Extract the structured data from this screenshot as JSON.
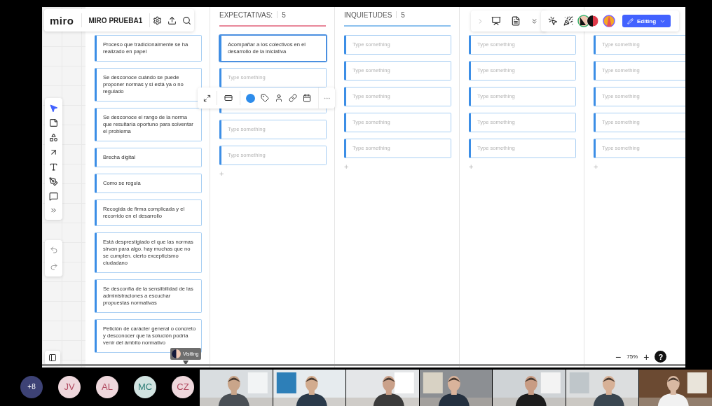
{
  "top_bar": {
    "logo": "miro",
    "board_name": "MIRO PRUEBA1"
  },
  "editing_button": {
    "label": "Editing"
  },
  "columns": [
    {
      "cards": [
        {
          "text": "Proceso que tradicionalmente se ha realizado en papel",
          "selected": false
        },
        {
          "text": "Se desconoce cuándo se puede proponer normas y si está ya o no regulado",
          "selected": false
        },
        {
          "text": "Se desconoce el rango de la norma que resultaría oportuno para solventar el problema",
          "selected": false
        },
        {
          "text": "Brecha digital",
          "selected": false
        },
        {
          "text": "Como se  regula",
          "selected": false
        },
        {
          "text": "Recogida de firma complicada y el recorrido en el desarrollo",
          "selected": false
        },
        {
          "text": "Está desprestigiado el que las normas sirvan para algo. hay muchas que no se cumplen. cierto excepticismo ciudadano",
          "selected": false
        },
        {
          "text": "Se desconfía de la sensiibilidad de las administraciones a escuchar propuestas normativas",
          "selected": false
        },
        {
          "text": "Petición de carácter general o concreto y desconocer que la solución podría venir del ámbito normativo",
          "selected": false
        }
      ]
    },
    {
      "title": "EXPECTATIVAS:",
      "count": "5",
      "color": "#e8879a",
      "add": "+",
      "cards": [
        {
          "text": "Acompañar a los colectivos en el desarrollo de la iniciativa",
          "selected": true
        },
        {
          "placeholder": "Type something",
          "selected": false
        },
        {
          "selected": false
        },
        {
          "placeholder": "Type something",
          "selected": false
        },
        {
          "placeholder": "Type something",
          "selected": false
        }
      ]
    },
    {
      "title": "INQUIETUDES",
      "count": "5",
      "color": "#8cc0ee",
      "add": "+",
      "cards": [
        {
          "placeholder": "Type something",
          "selected": false
        },
        {
          "placeholder": "Type something",
          "selected": false
        },
        {
          "placeholder": "Type something",
          "selected": false
        },
        {
          "placeholder": "Type something",
          "selected": false
        },
        {
          "placeholder": "Type something",
          "selected": false
        }
      ]
    },
    {
      "add": "+",
      "cards": [
        {
          "placeholder": "Type something",
          "selected": false
        },
        {
          "placeholder": "Type something",
          "selected": false
        },
        {
          "placeholder": "Type something",
          "selected": false
        },
        {
          "placeholder": "Type something",
          "selected": false
        },
        {
          "placeholder": "Type something",
          "selected": false
        }
      ]
    },
    {
      "add": "+",
      "cards": [
        {
          "placeholder": "Type something",
          "selected": false
        },
        {
          "placeholder": "Type something",
          "selected": false
        },
        {
          "placeholder": "Type something",
          "selected": false
        },
        {
          "placeholder": "Type something",
          "selected": false
        },
        {
          "placeholder": "Type something",
          "selected": false
        }
      ]
    }
  ],
  "visiting_badge": "Visiting",
  "zoom": {
    "minus": "−",
    "level": "75%",
    "plus": "+",
    "help": "?"
  },
  "participants": [
    {
      "initials": "+8",
      "kind": "count",
      "color": "#3d4275"
    },
    {
      "initials": "JV",
      "kind": "person",
      "color": "#b0485e"
    },
    {
      "initials": "AL",
      "kind": "person",
      "color": "#b0485e"
    },
    {
      "initials": "MC",
      "kind": "person",
      "color": "#2f7f78"
    },
    {
      "initials": "CZ",
      "kind": "person",
      "color": "#b0485e"
    }
  ]
}
